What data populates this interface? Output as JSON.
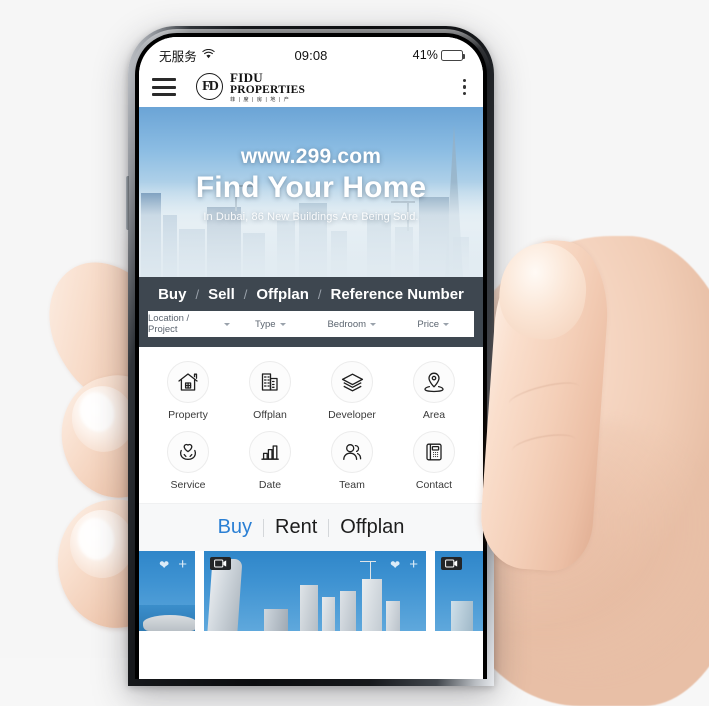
{
  "status_bar": {
    "carrier": "无服务",
    "wifi_icon": "wifi-icon",
    "time": "09:08",
    "battery_percent": "41%",
    "battery_level": 41
  },
  "app_header": {
    "menu_icon": "hamburger-menu-icon",
    "more_icon": "kebab-menu-icon",
    "logo": {
      "monogram": "FD",
      "line1": "FIDU",
      "line2": "PROPERTIES",
      "line3": "菲 | 度 | 房 | 地 | 产"
    }
  },
  "hero": {
    "url": "www.299.com",
    "headline": "Find Your Home",
    "subline": "In Dubai, 86 New Buildings Are Being Sold."
  },
  "nav": {
    "separator": "/",
    "tabs": [
      {
        "label": "Buy"
      },
      {
        "label": "Sell"
      },
      {
        "label": "Offplan"
      },
      {
        "label": "Reference Number"
      }
    ]
  },
  "filters": [
    {
      "label": "Location / Project"
    },
    {
      "label": "Type"
    },
    {
      "label": "Bedroom"
    },
    {
      "label": "Price"
    }
  ],
  "category_grid": [
    {
      "label": "Property",
      "icon": "house-icon"
    },
    {
      "label": "Offplan",
      "icon": "buildings-icon"
    },
    {
      "label": "Developer",
      "icon": "layers-icon"
    },
    {
      "label": "Area",
      "icon": "map-pin-icon"
    },
    {
      "label": "Service",
      "icon": "heart-hands-icon"
    },
    {
      "label": "Date",
      "icon": "bar-chart-icon"
    },
    {
      "label": "Team",
      "icon": "people-icon"
    },
    {
      "label": "Contact",
      "icon": "telephone-icon"
    }
  ],
  "listing_tabs": {
    "active": "Buy",
    "items": [
      {
        "label": "Buy",
        "active": true
      },
      {
        "label": "Rent",
        "active": false
      },
      {
        "label": "Offplan",
        "active": false
      }
    ]
  },
  "listing_cards": [
    {
      "video_badge": false,
      "favorite_icon": "heart-icon",
      "add_icon": "plus-icon",
      "has_actions": true
    },
    {
      "video_badge": true,
      "favorite_icon": "heart-icon",
      "add_icon": "plus-icon",
      "has_actions": true
    },
    {
      "video_badge": true,
      "favorite_icon": "heart-icon",
      "add_icon": "plus-icon",
      "has_actions": false
    }
  ],
  "colors": {
    "accent_blue": "#2a7fd4",
    "nav_dark": "#3e4750",
    "card_blue": "#3f93d2",
    "text_dark": "#1d1d1d",
    "page_bg": "#f6f6f6"
  }
}
